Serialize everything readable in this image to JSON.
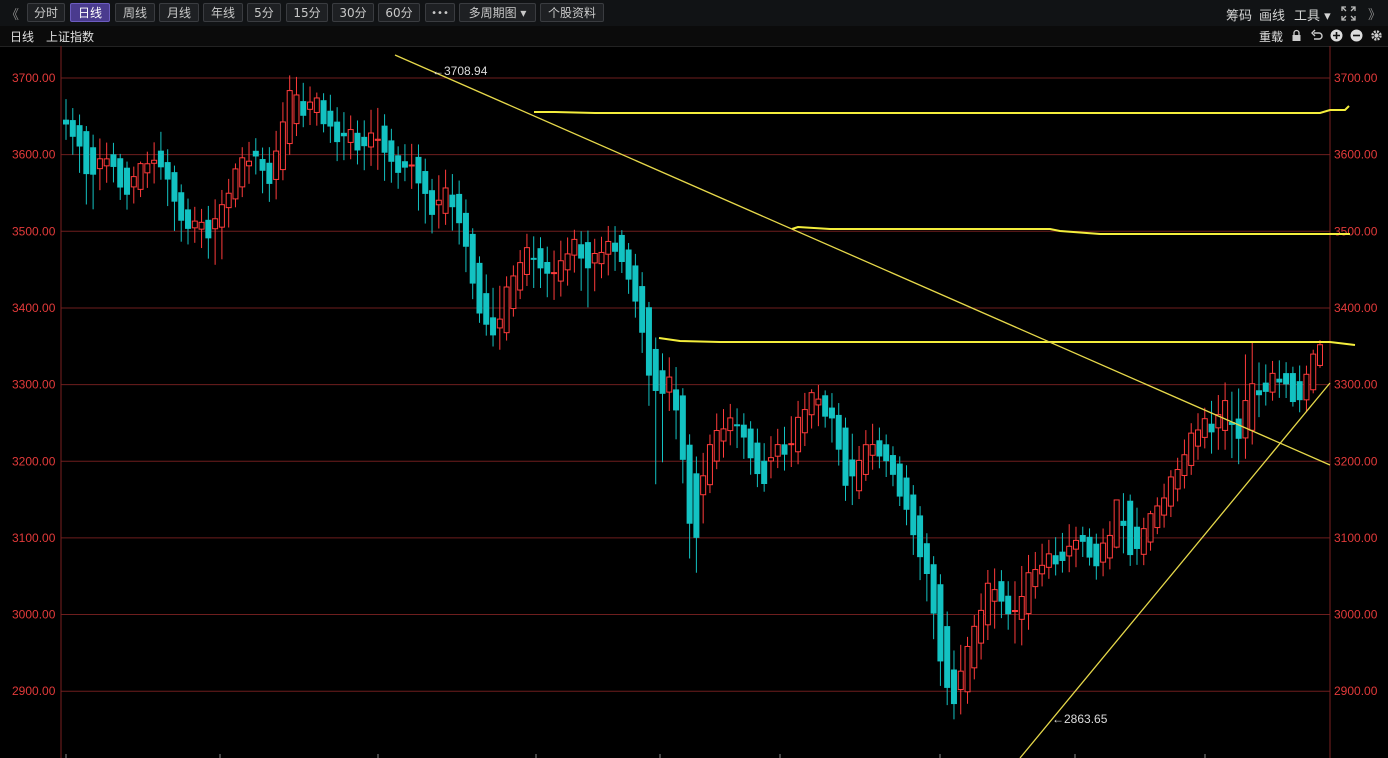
{
  "toolbar": {
    "collapse_left": "《",
    "periods": [
      "分时",
      "日线",
      "周线",
      "月线",
      "年线",
      "5分",
      "15分",
      "30分",
      "60分",
      "•••",
      "多周期图 ▾",
      "个股资料"
    ],
    "active_period": "日线",
    "right": {
      "chip": "筹码",
      "draw": "画线",
      "tools": "工具 ▾",
      "expand": "《》"
    }
  },
  "subbar": {
    "period_label": "日线",
    "index_name": "上证指数",
    "reload_label": "重载",
    "icons": [
      "lock-icon",
      "undo-icon",
      "zoom-in-icon",
      "zoom-out-icon",
      "settings-icon"
    ]
  },
  "colors": {
    "up": "#ff3b3b",
    "down": "#13c2c2",
    "grid": "#6e1e1e",
    "axis_text": "#e23a3a",
    "trend": "#e6d84a",
    "support": "#f4ee3c"
  },
  "annotations": {
    "high": "←3708.94",
    "low": "←2863.65"
  },
  "chart_data": {
    "type": "candlestick",
    "title": "",
    "ylim": [
      2840,
      3730
    ],
    "y_ticks": [
      "3700.00",
      "3600.00",
      "3500.00",
      "3400.00",
      "3300.00",
      "3200.00",
      "3100.00",
      "3000.00",
      "2900.00"
    ],
    "seed": [
      {
        "o": 3645,
        "c": 3640,
        "h": 3669,
        "l": 3620
      },
      {
        "o": 3640,
        "c": 3620,
        "h": 3650,
        "l": 3590
      },
      {
        "o": 3625,
        "c": 3560,
        "h": 3630,
        "l": 3520
      },
      {
        "o": 3575,
        "c": 3600,
        "h": 3615,
        "l": 3560
      },
      {
        "o": 3600,
        "c": 3585,
        "h": 3610,
        "l": 3570
      },
      {
        "o": 3585,
        "c": 3550,
        "h": 3590,
        "l": 3530
      },
      {
        "o": 3550,
        "c": 3575,
        "h": 3580,
        "l": 3540
      },
      {
        "o": 3580,
        "c": 3590,
        "h": 3605,
        "l": 3560
      },
      {
        "o": 3605,
        "c": 3585,
        "h": 3625,
        "l": 3570
      },
      {
        "o": 3585,
        "c": 3545,
        "h": 3590,
        "l": 3510
      },
      {
        "o": 3540,
        "c": 3500,
        "h": 3550,
        "l": 3480
      },
      {
        "o": 3500,
        "c": 3515,
        "h": 3525,
        "l": 3490
      },
      {
        "o": 3515,
        "c": 3490,
        "h": 3530,
        "l": 3470
      },
      {
        "o": 3495,
        "c": 3535,
        "h": 3545,
        "l": 3450
      },
      {
        "o": 3540,
        "c": 3560,
        "h": 3570,
        "l": 3530
      },
      {
        "o": 3560,
        "c": 3600,
        "h": 3610,
        "l": 3550
      },
      {
        "o": 3605,
        "c": 3600,
        "h": 3620,
        "l": 3580
      },
      {
        "o": 3590,
        "c": 3560,
        "h": 3600,
        "l": 3540
      },
      {
        "o": 3560,
        "c": 3620,
        "h": 3640,
        "l": 3550
      },
      {
        "o": 3620,
        "c": 3690,
        "h": 3709,
        "l": 3610
      },
      {
        "o": 3670,
        "c": 3650,
        "h": 3690,
        "l": 3640
      },
      {
        "o": 3655,
        "c": 3675,
        "h": 3680,
        "l": 3640
      },
      {
        "o": 3670,
        "c": 3640,
        "h": 3680,
        "l": 3630
      },
      {
        "o": 3640,
        "c": 3615,
        "h": 3660,
        "l": 3590
      },
      {
        "o": 3615,
        "c": 3635,
        "h": 3650,
        "l": 3600
      },
      {
        "o": 3630,
        "c": 3600,
        "h": 3640,
        "l": 3580
      },
      {
        "o": 3600,
        "c": 3645,
        "h": 3660,
        "l": 3590
      },
      {
        "o": 3640,
        "c": 3600,
        "h": 3650,
        "l": 3570
      },
      {
        "o": 3600,
        "c": 3575,
        "h": 3610,
        "l": 3560
      },
      {
        "o": 3580,
        "c": 3600,
        "h": 3615,
        "l": 3570
      },
      {
        "o": 3600,
        "c": 3555,
        "h": 3610,
        "l": 3520
      },
      {
        "o": 3550,
        "c": 3520,
        "h": 3560,
        "l": 3500
      },
      {
        "o": 3520,
        "c": 3560,
        "h": 3575,
        "l": 3515
      },
      {
        "o": 3560,
        "c": 3520,
        "h": 3570,
        "l": 3500
      },
      {
        "o": 3520,
        "c": 3460,
        "h": 3530,
        "l": 3440
      },
      {
        "o": 3455,
        "c": 3390,
        "h": 3460,
        "l": 3380
      },
      {
        "o": 3390,
        "c": 3360,
        "h": 3420,
        "l": 3355
      },
      {
        "o": 3360,
        "c": 3410,
        "h": 3430,
        "l": 3345
      },
      {
        "o": 3410,
        "c": 3445,
        "h": 3460,
        "l": 3400
      },
      {
        "o": 3445,
        "c": 3480,
        "h": 3495,
        "l": 3430
      },
      {
        "o": 3480,
        "c": 3455,
        "h": 3490,
        "l": 3430
      },
      {
        "o": 3455,
        "c": 3430,
        "h": 3470,
        "l": 3410
      },
      {
        "o": 3430,
        "c": 3470,
        "h": 3485,
        "l": 3420
      },
      {
        "o": 3470,
        "c": 3490,
        "h": 3500,
        "l": 3450
      },
      {
        "o": 3490,
        "c": 3450,
        "h": 3500,
        "l": 3400
      },
      {
        "o": 3450,
        "c": 3470,
        "h": 3485,
        "l": 3435
      },
      {
        "o": 3470,
        "c": 3498,
        "h": 3506,
        "l": 3450
      },
      {
        "o": 3495,
        "c": 3460,
        "h": 3500,
        "l": 3450
      },
      {
        "o": 3460,
        "c": 3420,
        "h": 3470,
        "l": 3400
      },
      {
        "o": 3420,
        "c": 3335,
        "h": 3430,
        "l": 3320
      },
      {
        "o": 3335,
        "c": 3280,
        "h": 3345,
        "l": 3150
      },
      {
        "o": 3290,
        "c": 3310,
        "h": 3330,
        "l": 3270
      },
      {
        "o": 3300,
        "c": 3225,
        "h": 3310,
        "l": 3200
      },
      {
        "o": 3195,
        "c": 3065,
        "h": 3200,
        "l": 3025
      },
      {
        "o": 3150,
        "c": 3200,
        "h": 3210,
        "l": 3140
      },
      {
        "o": 3200,
        "c": 3240,
        "h": 3260,
        "l": 3190
      },
      {
        "o": 3240,
        "c": 3255,
        "h": 3270,
        "l": 3225
      },
      {
        "o": 3255,
        "c": 3235,
        "h": 3265,
        "l": 3215
      },
      {
        "o": 3240,
        "c": 3200,
        "h": 3250,
        "l": 3180
      },
      {
        "o": 3200,
        "c": 3170,
        "h": 3220,
        "l": 3160
      },
      {
        "o": 3200,
        "c": 3230,
        "h": 3240,
        "l": 3195
      },
      {
        "o": 3230,
        "c": 3200,
        "h": 3245,
        "l": 3190
      },
      {
        "o": 3210,
        "c": 3265,
        "h": 3280,
        "l": 3200
      },
      {
        "o": 3260,
        "c": 3290,
        "h": 3292,
        "l": 3245
      },
      {
        "o": 3285,
        "c": 3270,
        "h": 3295,
        "l": 3255
      },
      {
        "o": 3270,
        "c": 3240,
        "h": 3280,
        "l": 3220
      },
      {
        "o": 3240,
        "c": 3160,
        "h": 3250,
        "l": 3140
      },
      {
        "o": 3160,
        "c": 3200,
        "h": 3215,
        "l": 3150
      },
      {
        "o": 3200,
        "c": 3230,
        "h": 3250,
        "l": 3190
      },
      {
        "o": 3230,
        "c": 3210,
        "h": 3240,
        "l": 3195
      },
      {
        "o": 3205,
        "c": 3180,
        "h": 3215,
        "l": 3165
      },
      {
        "o": 3180,
        "c": 3140,
        "h": 3195,
        "l": 3120
      },
      {
        "o": 3140,
        "c": 3085,
        "h": 3150,
        "l": 3060
      },
      {
        "o": 3080,
        "c": 3040,
        "h": 3090,
        "l": 3010
      },
      {
        "o": 3035,
        "c": 2930,
        "h": 3045,
        "l": 2900
      },
      {
        "o": 2930,
        "c": 2880,
        "h": 2950,
        "l": 2864
      },
      {
        "o": 2890,
        "c": 2945,
        "h": 2960,
        "l": 2875
      },
      {
        "o": 2945,
        "c": 2990,
        "h": 3010,
        "l": 2930
      },
      {
        "o": 2990,
        "c": 3045,
        "h": 3060,
        "l": 2970
      },
      {
        "o": 3045,
        "c": 3020,
        "h": 3055,
        "l": 3000
      },
      {
        "o": 3015,
        "c": 2985,
        "h": 3030,
        "l": 2970
      },
      {
        "o": 2985,
        "c": 3040,
        "h": 3070,
        "l": 2960
      },
      {
        "o": 3040,
        "c": 3060,
        "h": 3080,
        "l": 3030
      },
      {
        "o": 3060,
        "c": 3080,
        "h": 3095,
        "l": 3050
      },
      {
        "o": 3080,
        "c": 3070,
        "h": 3100,
        "l": 3055
      },
      {
        "o": 3070,
        "c": 3105,
        "h": 3115,
        "l": 3060
      },
      {
        "o": 3105,
        "c": 3095,
        "h": 3110,
        "l": 3080
      },
      {
        "o": 3095,
        "c": 3060,
        "h": 3105,
        "l": 3050
      },
      {
        "o": 3060,
        "c": 3100,
        "h": 3110,
        "l": 3050
      },
      {
        "o": 3100,
        "c": 3150,
        "h": 3155,
        "l": 3095
      },
      {
        "o": 3150,
        "c": 3075,
        "h": 3155,
        "l": 3065
      },
      {
        "o": 3075,
        "c": 3110,
        "h": 3120,
        "l": 3065
      },
      {
        "o": 3110,
        "c": 3130,
        "h": 3140,
        "l": 3100
      },
      {
        "o": 3130,
        "c": 3165,
        "h": 3175,
        "l": 3120
      },
      {
        "o": 3165,
        "c": 3190,
        "h": 3200,
        "l": 3150
      },
      {
        "o": 3190,
        "c": 3235,
        "h": 3245,
        "l": 3180
      },
      {
        "o": 3230,
        "c": 3250,
        "h": 3268,
        "l": 3220
      },
      {
        "o": 3250,
        "c": 3240,
        "h": 3275,
        "l": 3215
      },
      {
        "o": 3240,
        "c": 3280,
        "h": 3300,
        "l": 3220
      },
      {
        "o": 3260,
        "c": 3220,
        "h": 3280,
        "l": 3200
      },
      {
        "o": 3220,
        "c": 3300,
        "h": 3360,
        "l": 3205
      },
      {
        "o": 3305,
        "c": 3285,
        "h": 3320,
        "l": 3270
      },
      {
        "o": 3290,
        "c": 3315,
        "h": 3330,
        "l": 3280
      },
      {
        "o": 3315,
        "c": 3305,
        "h": 3330,
        "l": 3290
      },
      {
        "o": 3310,
        "c": 3275,
        "h": 3320,
        "l": 3265
      },
      {
        "o": 3275,
        "c": 3320,
        "h": 3325,
        "l": 3268
      },
      {
        "o": 3325,
        "c": 3352,
        "h": 3358,
        "l": 3322
      }
    ]
  }
}
